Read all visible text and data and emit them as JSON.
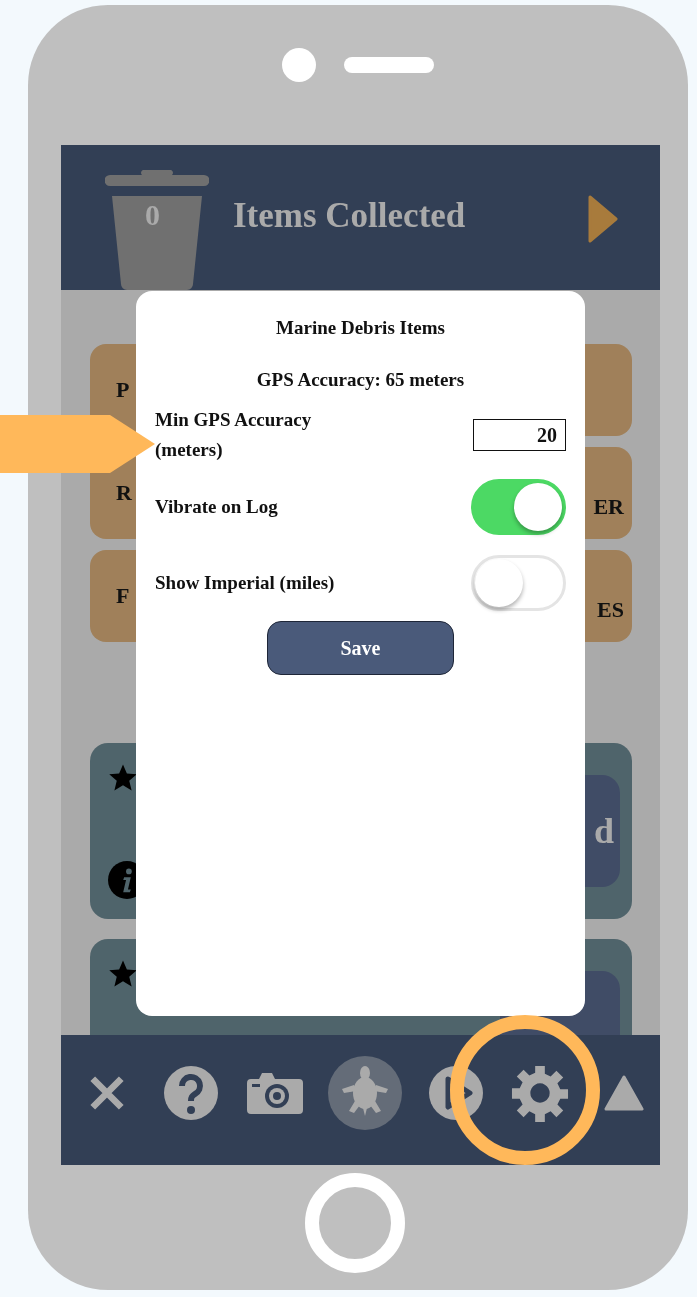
{
  "header": {
    "count": "0",
    "title": "Items Collected"
  },
  "category_rows": [
    {
      "left_text": "P"
    },
    {
      "left_text": "R",
      "right_text": "ER"
    },
    {
      "left_text": "F",
      "right_text": "ES"
    }
  ],
  "item_cards": [
    {
      "kind": "labeled",
      "button_text": "d"
    },
    {
      "kind": "blank"
    }
  ],
  "dialog": {
    "title": "Marine Debris Items",
    "gps_accuracy": "GPS Accuracy: 65 meters",
    "settings": [
      {
        "kind": "number",
        "label": "Min GPS Accuracy (meters)",
        "value": "20"
      },
      {
        "kind": "toggle",
        "label": "Vibrate on Log",
        "on": true
      },
      {
        "kind": "toggle",
        "label": "Show Imperial (miles)",
        "on": false
      }
    ],
    "save_button": "Save"
  },
  "toolbar": [
    {
      "kind": "close",
      "selected": false
    },
    {
      "kind": "help",
      "selected": false
    },
    {
      "kind": "camera",
      "selected": false
    },
    {
      "kind": "turtle",
      "selected": true
    },
    {
      "kind": "play",
      "selected": false
    },
    {
      "kind": "settings",
      "selected": false
    },
    {
      "kind": "up",
      "selected": false
    }
  ]
}
